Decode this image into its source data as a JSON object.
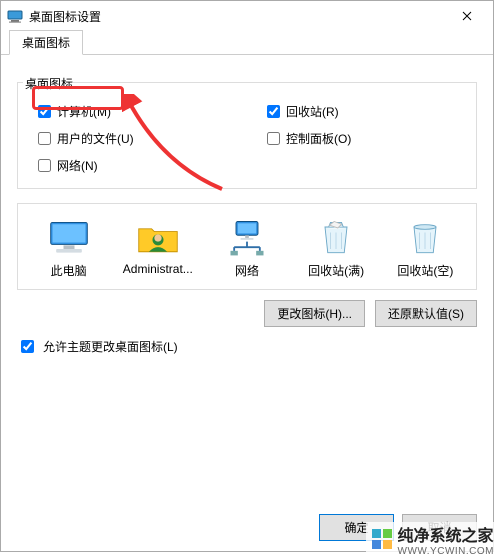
{
  "window": {
    "title": "桌面图标设置"
  },
  "tab": {
    "label": "桌面图标"
  },
  "group": {
    "label": "桌面图标"
  },
  "checks": {
    "computer": {
      "label": "计算机(M)",
      "checked": true
    },
    "recycle": {
      "label": "回收站(R)",
      "checked": true
    },
    "userfiles": {
      "label": "用户的文件(U)",
      "checked": false
    },
    "control": {
      "label": "控制面板(O)",
      "checked": false
    },
    "network": {
      "label": "网络(N)",
      "checked": false
    }
  },
  "icons": [
    {
      "name": "此电脑",
      "icon": "pc"
    },
    {
      "name": "Administrat...",
      "icon": "user"
    },
    {
      "name": "网络",
      "icon": "net"
    },
    {
      "name": "回收站(满)",
      "icon": "binfull"
    },
    {
      "name": "回收站(空)",
      "icon": "binempty"
    }
  ],
  "buttons": {
    "change": "更改图标(H)...",
    "restore": "还原默认值(S)"
  },
  "allowTheme": {
    "label": "允许主题更改桌面图标(L)",
    "checked": true
  },
  "dialog": {
    "ok": "确定",
    "cancel": "取消"
  },
  "watermark": {
    "text": "纯净系统之家",
    "sub": "WWW.YCWIN.COM"
  }
}
